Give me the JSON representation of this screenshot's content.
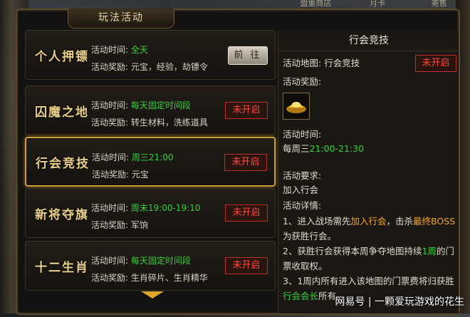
{
  "top_nav": [
    "盟重商店",
    "月卡",
    "寄售"
  ],
  "window_title": "玩法活动",
  "labels": {
    "time": "活动时间:",
    "reward": "活动奖励:"
  },
  "activities": [
    {
      "name": "个人押镖",
      "time": "全天",
      "reward": "元宝，经验，劫镖令",
      "button": "前 往",
      "status": "go"
    },
    {
      "name": "囚魔之地",
      "time": "每天固定时间段",
      "reward": "转生材料，洗练道具",
      "button": "未开启",
      "status": "closed"
    },
    {
      "name": "行会竞技",
      "time": "周三21:00",
      "reward": "元宝",
      "button": "未开启",
      "status": "closed",
      "selected": true
    },
    {
      "name": "新将夺旗",
      "time": "周末19:00-19:10",
      "reward": "军饷",
      "button": "未开启",
      "status": "closed"
    },
    {
      "name": "十二生肖",
      "time": "每天固定时间段",
      "reward": "生肖碎片、生肖精华",
      "button": "未开启",
      "status": "closed"
    }
  ],
  "detail": {
    "title": "行会竞技",
    "map_label": "活动地图:",
    "map_value": "行会竞技",
    "status_button": "未开启",
    "reward_label": "活动奖励:",
    "reward_icon": "gold-ingot-icon",
    "time_label": "活动时间:",
    "time_prefix": "每周三",
    "time_value": "21:00-21:30",
    "req_label": "活动要求:",
    "req_value": "加入行会",
    "info_label": "活动详情:",
    "info": [
      [
        "1、进入战场需先",
        "加入行会",
        "，击杀",
        "最终BOSS",
        "为获胜行会。"
      ],
      [
        "2、获胜行会获得本周争夺地图持续",
        "1周",
        "的门票收取权。",
        "",
        ""
      ],
      [
        "3、1周内所有进入该地图的门票费将归获胜",
        "行会会长",
        "所有。",
        "",
        ""
      ]
    ]
  },
  "watermark": "网易号 | 一颗爱玩游戏的花生",
  "colors": {
    "green": "#35d13c",
    "orange": "#f5a623",
    "red": "#ff4a3a",
    "gold": "#e8cf8a"
  }
}
